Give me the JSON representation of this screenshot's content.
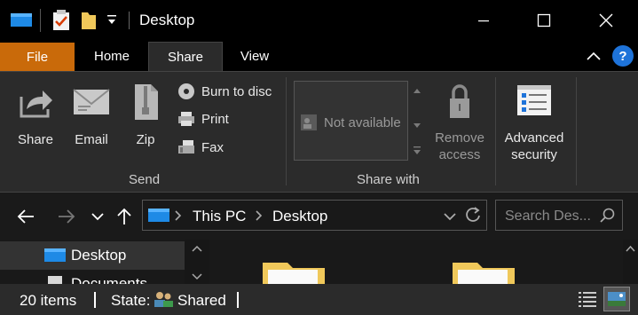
{
  "window": {
    "title": "Desktop",
    "quick_access": [
      "folder-icon",
      "properties-icon",
      "new-folder-icon",
      "customize-dropdown"
    ]
  },
  "ribbon_tabs": [
    {
      "label": "File",
      "active": false,
      "color": "#c96a0a"
    },
    {
      "label": "Home",
      "active": false
    },
    {
      "label": "Share",
      "active": true
    },
    {
      "label": "View",
      "active": false
    }
  ],
  "help_label": "?",
  "ribbon": {
    "send": {
      "share_label": "Share",
      "email_label": "Email",
      "zip_label": "Zip",
      "burn_label": "Burn to disc",
      "print_label": "Print",
      "fax_label": "Fax",
      "group_label": "Send"
    },
    "share_with": {
      "gallery_item": "Not available",
      "remove_access_line1": "Remove",
      "remove_access_line2": "access",
      "group_label": "Share with"
    },
    "advanced_security_line1": "Advanced",
    "advanced_security_line2": "security"
  },
  "address": {
    "crumbs": [
      "This PC",
      "Desktop"
    ],
    "search_placeholder": "Search Des..."
  },
  "nav_pane": {
    "items": [
      "Desktop",
      "Documents"
    ]
  },
  "status": {
    "item_count": "20 items",
    "state_label": "State:",
    "state_value": "Shared"
  },
  "colors": {
    "accent": "#1e73d9",
    "file_tab": "#c96a0a",
    "ribbon_bg": "#2b2b2b"
  }
}
